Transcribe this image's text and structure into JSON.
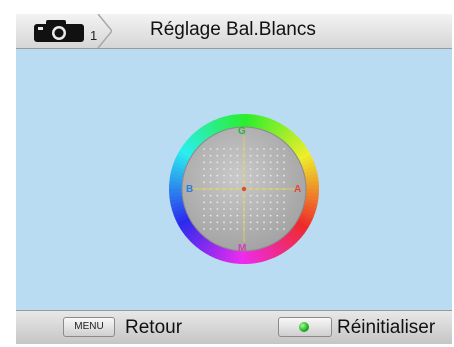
{
  "header": {
    "camera_icon": "camera-icon",
    "mode_number": "1",
    "title": "Réglage Bal.Blancs"
  },
  "wheel": {
    "labels": {
      "top": "G",
      "bottom": "M",
      "left": "B",
      "right": "A"
    },
    "colors": {
      "top": "#2fb43b",
      "bottom": "#d63cb6",
      "left": "#2b7fd6",
      "right": "#e0483a"
    },
    "grid_dots": 13,
    "selection": {
      "ga": 0,
      "ba": 0
    }
  },
  "footer": {
    "menu_key": "MENU",
    "back_label": "Retour",
    "ok_icon": "green-button-icon",
    "reset_label": "Réinitialiser"
  },
  "colors": {
    "screen_bg": "#b9dcf3",
    "bar_bg": "#dcdcdc"
  }
}
